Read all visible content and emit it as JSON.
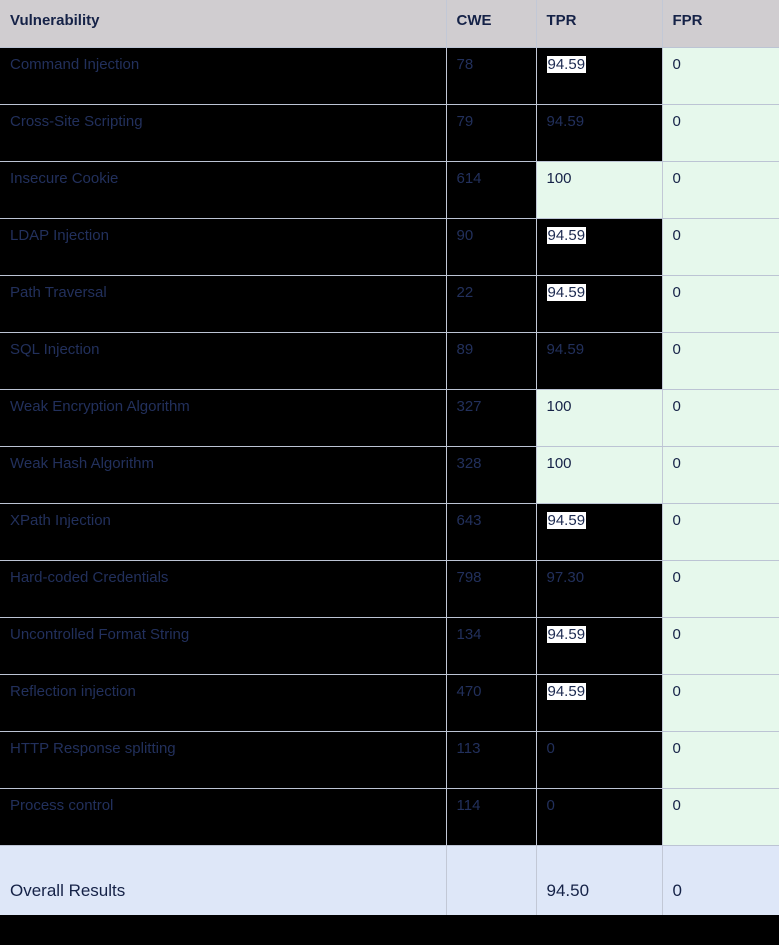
{
  "table": {
    "columns": [
      {
        "key": "vulnerability",
        "label": "Vulnerability"
      },
      {
        "key": "cwe",
        "label": "CWE"
      },
      {
        "key": "tpr",
        "label": "TPR"
      },
      {
        "key": "fpr",
        "label": "FPR"
      }
    ],
    "rows": [
      {
        "vulnerability": "Command Injection",
        "cwe": "78",
        "tpr": "94.59",
        "fpr": "0",
        "tpr_highlighted": true,
        "tpr_cell_style": "dark"
      },
      {
        "vulnerability": "Cross-Site Scripting",
        "cwe": "79",
        "tpr": "94.59",
        "fpr": "0",
        "tpr_highlighted": false,
        "tpr_cell_style": "dark"
      },
      {
        "vulnerability": "Insecure Cookie",
        "cwe": "614",
        "tpr": "100",
        "fpr": "0",
        "tpr_highlighted": false,
        "tpr_cell_style": "mint"
      },
      {
        "vulnerability": "LDAP Injection",
        "cwe": "90",
        "tpr": "94.59",
        "fpr": "0",
        "tpr_highlighted": true,
        "tpr_cell_style": "dark"
      },
      {
        "vulnerability": "Path Traversal",
        "cwe": "22",
        "tpr": "94.59",
        "fpr": "0",
        "tpr_highlighted": true,
        "tpr_cell_style": "dark"
      },
      {
        "vulnerability": "SQL Injection",
        "cwe": "89",
        "tpr": "94.59",
        "fpr": "0",
        "tpr_highlighted": false,
        "tpr_cell_style": "dark"
      },
      {
        "vulnerability": "Weak Encryption Algorithm",
        "cwe": "327",
        "tpr": "100",
        "fpr": "0",
        "tpr_highlighted": false,
        "tpr_cell_style": "mint"
      },
      {
        "vulnerability": "Weak Hash Algorithm",
        "cwe": "328",
        "tpr": "100",
        "fpr": "0",
        "tpr_highlighted": false,
        "tpr_cell_style": "mint"
      },
      {
        "vulnerability": "XPath Injection",
        "cwe": "643",
        "tpr": "94.59",
        "fpr": "0",
        "tpr_highlighted": true,
        "tpr_cell_style": "dark"
      },
      {
        "vulnerability": "Hard-coded Credentials",
        "cwe": "798",
        "tpr": "97.30",
        "fpr": "0",
        "tpr_highlighted": false,
        "tpr_cell_style": "dark"
      },
      {
        "vulnerability": "Uncontrolled Format String",
        "cwe": "134",
        "tpr": "94.59",
        "fpr": "0",
        "tpr_highlighted": true,
        "tpr_cell_style": "dark"
      },
      {
        "vulnerability": "Reflection injection",
        "cwe": "470",
        "tpr": "94.59",
        "fpr": "0",
        "tpr_highlighted": true,
        "tpr_cell_style": "dark"
      },
      {
        "vulnerability": "HTTP Response splitting",
        "cwe": "113",
        "tpr": "0",
        "fpr": "0",
        "tpr_highlighted": false,
        "tpr_cell_style": "dark"
      },
      {
        "vulnerability": "Process control",
        "cwe": "114",
        "tpr": "0",
        "fpr": "0",
        "tpr_highlighted": false,
        "tpr_cell_style": "dark"
      }
    ],
    "footer": {
      "label": "Overall Results",
      "cwe": "",
      "tpr": "94.50",
      "fpr": "0"
    }
  },
  "colors": {
    "header_background": "#d0cdd0",
    "row_dark_background": "#000000",
    "row_mint_background": "#e6f8ec",
    "footer_background": "#dee7f8",
    "text_navy": "#152247",
    "text_dim_navy": "#22305c",
    "highlight_background": "#ffffff",
    "border": "#bcc4d4"
  }
}
